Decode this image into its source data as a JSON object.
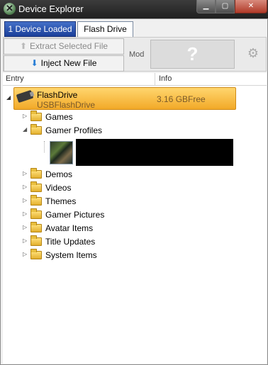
{
  "window": {
    "title": "Device Explorer"
  },
  "tabs": [
    {
      "label": "1 Device Loaded"
    },
    {
      "label": "Flash Drive"
    }
  ],
  "toolbar": {
    "extract_label": "Extract Selected File",
    "inject_label": "Inject New File",
    "mod_label": "Mod",
    "mod_placeholder": "?",
    "settings_icon": "gear-icon"
  },
  "columns": {
    "entry": "Entry",
    "info": "Info"
  },
  "tree": {
    "root": {
      "name": "FlashDrive",
      "type": "USBFlashDrive",
      "info": "3.16 GBFree"
    },
    "children": [
      {
        "label": "Games",
        "expanded": false
      },
      {
        "label": "Gamer Profiles",
        "expanded": true
      },
      {
        "label": "Demos",
        "expanded": false
      },
      {
        "label": "Videos",
        "expanded": false
      },
      {
        "label": "Themes",
        "expanded": false
      },
      {
        "label": "Gamer Pictures",
        "expanded": false
      },
      {
        "label": "Avatar Items",
        "expanded": false
      },
      {
        "label": "Title Updates",
        "expanded": false
      },
      {
        "label": "System Items",
        "expanded": false
      }
    ]
  },
  "colors": {
    "active_tab": "#2a56b8",
    "selection": "#f6b93b",
    "folder": "#f2c94c"
  }
}
